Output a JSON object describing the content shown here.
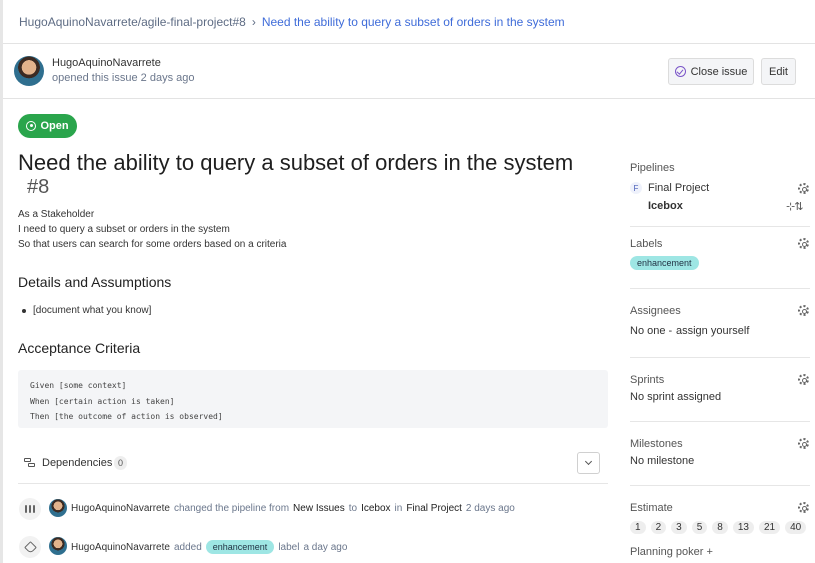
{
  "breadcrumb": {
    "repo": "HugoAquinoNavarrete/agile-final-project#8",
    "issue": "Need the ability to query a subset of orders in the system"
  },
  "author": {
    "name": "HugoAquinoNavarrete",
    "subtitle": "opened this issue 2 days ago"
  },
  "actions": {
    "close_label": "Close issue",
    "edit_label": "Edit"
  },
  "status": "Open",
  "issue": {
    "title": "Need the ability to query a subset of orders in the system",
    "number": "#8",
    "description": [
      "As a Stakeholder",
      "I need to query a subset or orders in the system",
      "So that users can search for some orders based on a criteria"
    ],
    "details_heading": "Details and Assumptions",
    "details_items": [
      "[document what you know]"
    ],
    "acceptance_heading": "Acceptance Criteria",
    "acceptance_code": [
      "Given [some context]",
      "When [certain action is taken]",
      "Then [the outcome of action is observed]"
    ]
  },
  "dependencies": {
    "label": "Dependencies",
    "count": "0"
  },
  "activity": [
    {
      "user": "HugoAquinoNavarrete",
      "text1": "changed the pipeline from",
      "from": "New Issues",
      "to_word": "to",
      "to": "Icebox",
      "in_word": "in",
      "workspace": "Final Project",
      "time": "2 days ago"
    },
    {
      "user": "HugoAquinoNavarrete",
      "text1": "added",
      "label": "enhancement",
      "text2": "label",
      "time": "a day ago"
    }
  ],
  "sidebar": {
    "pipelines": {
      "title": "Pipelines",
      "badge": "F",
      "workspace": "Final Project",
      "pipeline": "Icebox"
    },
    "labels": {
      "title": "Labels",
      "value": "enhancement"
    },
    "assignees": {
      "title": "Assignees",
      "value": "No one -",
      "link": "assign yourself"
    },
    "sprints": {
      "title": "Sprints",
      "value": "No sprint assigned"
    },
    "milestones": {
      "title": "Milestones",
      "value": "No milestone"
    },
    "estimate": {
      "title": "Estimate",
      "values": [
        "1",
        "2",
        "3",
        "5",
        "8",
        "13",
        "21",
        "40"
      ]
    },
    "poker": "Planning poker +"
  },
  "colors": {
    "open_badge": "#2aa54c",
    "link": "#3f6cd9",
    "label_pill": "#9ee6e4"
  }
}
